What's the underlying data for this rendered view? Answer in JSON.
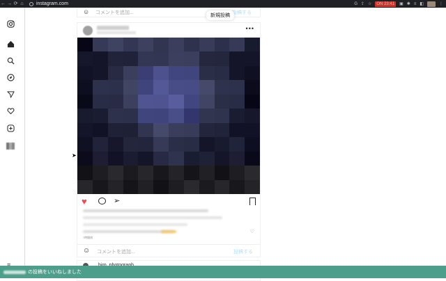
{
  "browser": {
    "url": "instagram.com",
    "badge": "ON 23:41"
  },
  "top_card": {
    "comment_placeholder": "コメントを追加...",
    "post_label": "投稿する"
  },
  "tooltip": {
    "label": "新規投稿"
  },
  "post": {
    "time": "7時間前",
    "comment_placeholder": "コメントを追加...",
    "post_label": "投稿する",
    "liked": true
  },
  "next_post": {
    "username": "hiro_photograph"
  },
  "toast": {
    "message": "の投稿をいいねしました"
  },
  "colors": {
    "like_red": "#ed4956",
    "toast_bg": "#4d9e8a",
    "post_link": "#b2dffc"
  },
  "sidebar_icons": [
    "instagram-logo-icon",
    "home-icon",
    "search-icon",
    "explore-compass-icon",
    "messages-send-icon",
    "notifications-heart-icon",
    "create-plus-icon",
    "profile-avatar-icon",
    "menu-icon"
  ]
}
